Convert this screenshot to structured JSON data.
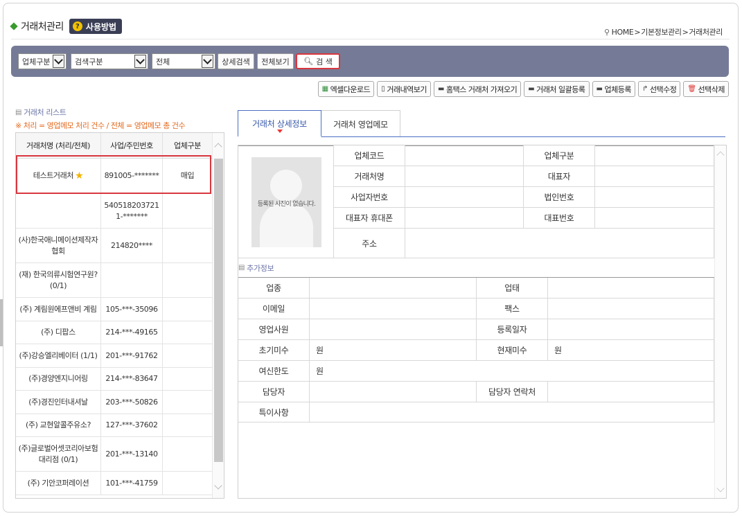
{
  "header": {
    "title": "거래처관리",
    "help_label": "사용방법",
    "help_icon_glyph": "?",
    "breadcrumb": [
      "HOME",
      "기본정보관리",
      "거래처관리"
    ]
  },
  "search": {
    "type_select": "업체구분",
    "field_select": "검색구분",
    "scope_select": "전체",
    "detail_search_label": "상세검색",
    "show_all_label": "전체보기",
    "search_label": "검 색"
  },
  "toolbar": [
    {
      "label": "엑셀다운로드",
      "icon": "excel-icon",
      "glyph": "▦"
    },
    {
      "label": "거래내역보기",
      "icon": "document-icon",
      "glyph": "▯"
    },
    {
      "label": "홈택스 거래처 가져오기",
      "icon": "save-icon",
      "glyph": "▬"
    },
    {
      "label": "거래처 일괄등록",
      "icon": "save-icon",
      "glyph": "▬"
    },
    {
      "label": "업체등록",
      "icon": "save-icon",
      "glyph": "▬"
    },
    {
      "label": "선택수정",
      "icon": "edit-icon",
      "glyph": "↱"
    },
    {
      "label": "선택삭제",
      "icon": "trash-icon",
      "glyph": "🗑"
    }
  ],
  "list": {
    "title": "거래처 리스트",
    "note": "※ 처리 = 영업메모 처리 건수 / 전체 = 영업메모 총 건수",
    "columns": [
      "거래처명 (처리/전체)",
      "사업/주민번호",
      "업체구분"
    ],
    "rows": [
      {
        "name": "테스트거래처",
        "number": "891005-*******",
        "type": "매입",
        "star": true,
        "h": 51
      },
      {
        "name": "",
        "number": "5405182037211-*******",
        "type": "",
        "h": 50
      },
      {
        "name": "(사)한국애니메이션제작자협회",
        "number": "214820****",
        "type": "",
        "h": 50
      },
      {
        "name": "(재) 한국의류시험연구원? (0/1)",
        "number": "",
        "type": "",
        "h": 50
      },
      {
        "name": "(주) 계림원에프앤비 계림",
        "number": "105-***-35096",
        "type": "",
        "h": 34
      },
      {
        "name": "(주) 디팝스",
        "number": "214-***-49165",
        "type": "",
        "h": 33
      },
      {
        "name": "(주)강승엘리베이터 (1/1)",
        "number": "201-***-91762",
        "type": "",
        "h": 34
      },
      {
        "name": "(주)경양엔지니어링",
        "number": "214-***-83647",
        "type": "",
        "h": 33
      },
      {
        "name": "(주)경진인터내셔날",
        "number": "203-***-50826",
        "type": "",
        "h": 34
      },
      {
        "name": "(주) 교현알콜주유소?",
        "number": "127-***-37602",
        "type": "",
        "h": 33
      },
      {
        "name": "(주)글로벌어셋코리아보험대리점 (0/1)",
        "number": "201-***-13140",
        "type": "",
        "h": 50
      },
      {
        "name": "(주) 기안코퍼레이션",
        "number": "101-***-41759",
        "type": "",
        "h": 34
      }
    ]
  },
  "detail": {
    "tabs": [
      "거래처 상세정보",
      "거래처 영업메모"
    ],
    "no_photo_text": "등록된 사진이 없습니다.",
    "labels": {
      "company_code": "업체코드",
      "company_type": "업체구분",
      "name": "거래처명",
      "ceo": "대표자",
      "biz_no": "사업자번호",
      "corp_no": "법인번호",
      "ceo_mobile": "대표자 휴대폰",
      "main_phone": "대표번호",
      "address": "주소"
    },
    "additional_title": "추가정보",
    "extra": {
      "industry": "업종",
      "business": "업태",
      "email": "이메일",
      "fax": "팩스",
      "sales_rep": "영업사원",
      "reg_date": "등록일자",
      "initial_balance": "초기미수",
      "current_balance": "현재미수",
      "credit_limit": "여신한도",
      "contact": "담당자",
      "contact_phone": "담당자 연락처",
      "remarks": "특이사항",
      "initial_balance_value": "원",
      "current_balance_value": "원",
      "credit_limit_value": "원"
    }
  }
}
